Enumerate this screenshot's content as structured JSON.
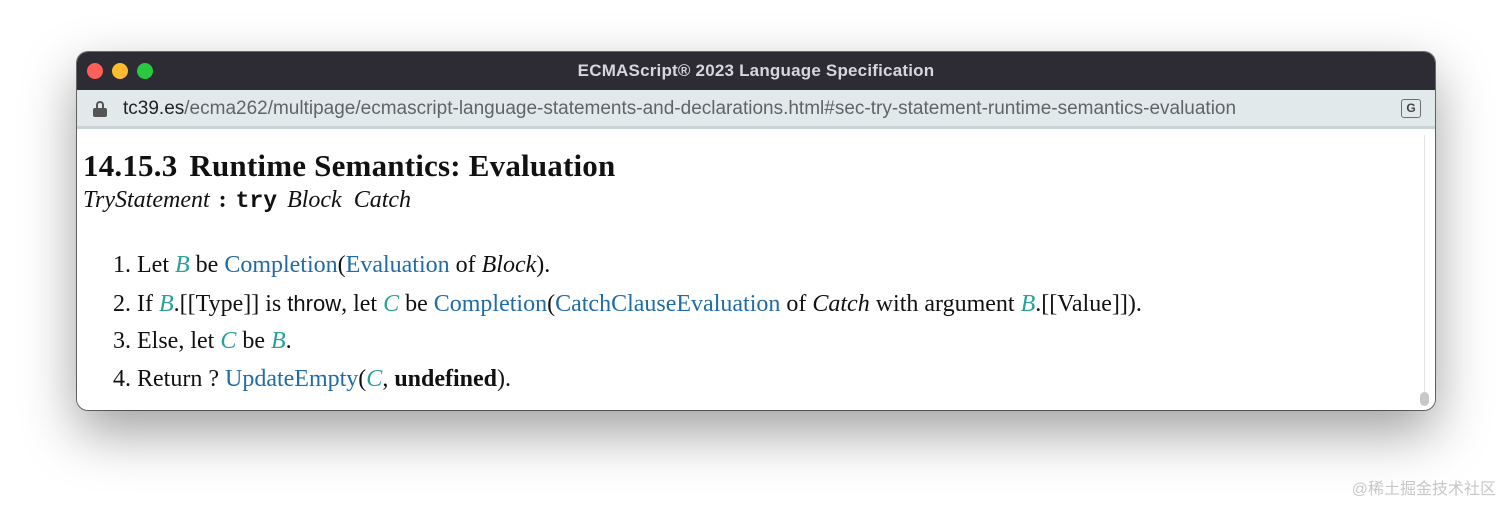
{
  "window": {
    "title": "ECMAScript® 2023 Language Specification"
  },
  "urlbar": {
    "host": "tc39.es",
    "path": "/ecma262/multipage/ecmascript-language-statements-and-declarations.html#sec-try-statement-runtime-semantics-evaluation"
  },
  "section": {
    "number": "14.15.3",
    "title": "Runtime Semantics: Evaluation"
  },
  "grammar": {
    "lhs": "TryStatement",
    "colon": ":",
    "keyword": "try",
    "rhs1": "Block",
    "rhs2": "Catch"
  },
  "steps": [
    {
      "n": "1.",
      "let": "Let",
      "var": "B",
      "be": "be",
      "link1": "Completion",
      "open": "(",
      "link2": "Evaluation",
      "of": "of",
      "arg": "Block",
      "close": ")."
    },
    {
      "n": "2.",
      "if": "If",
      "var1": "B",
      "type": ".[[Type]] is",
      "throw": "throw",
      "comma_let": ", let",
      "var2": "C",
      "be": "be",
      "link1": "Completion",
      "open": "(",
      "link2": "CatchClauseEvaluation",
      "of": "of",
      "arg": "Catch",
      "with": "with argument",
      "var3": "B",
      "value": ".[[Value]])."
    },
    {
      "n": "3.",
      "else": "Else, let",
      "var1": "C",
      "be": "be",
      "var2": "B",
      "end": "."
    },
    {
      "n": "4.",
      "ret": "Return ?",
      "link": "UpdateEmpty",
      "open": "(",
      "var": "C",
      "comma": ",",
      "undef": "undefined",
      "close": ")."
    }
  ],
  "watermark": "@稀土掘金技术社区",
  "colors": {
    "titlebar": "#2d2b33",
    "urlbar": "#e2e9eb",
    "link": "#206ca7",
    "variable": "#2aa198"
  }
}
